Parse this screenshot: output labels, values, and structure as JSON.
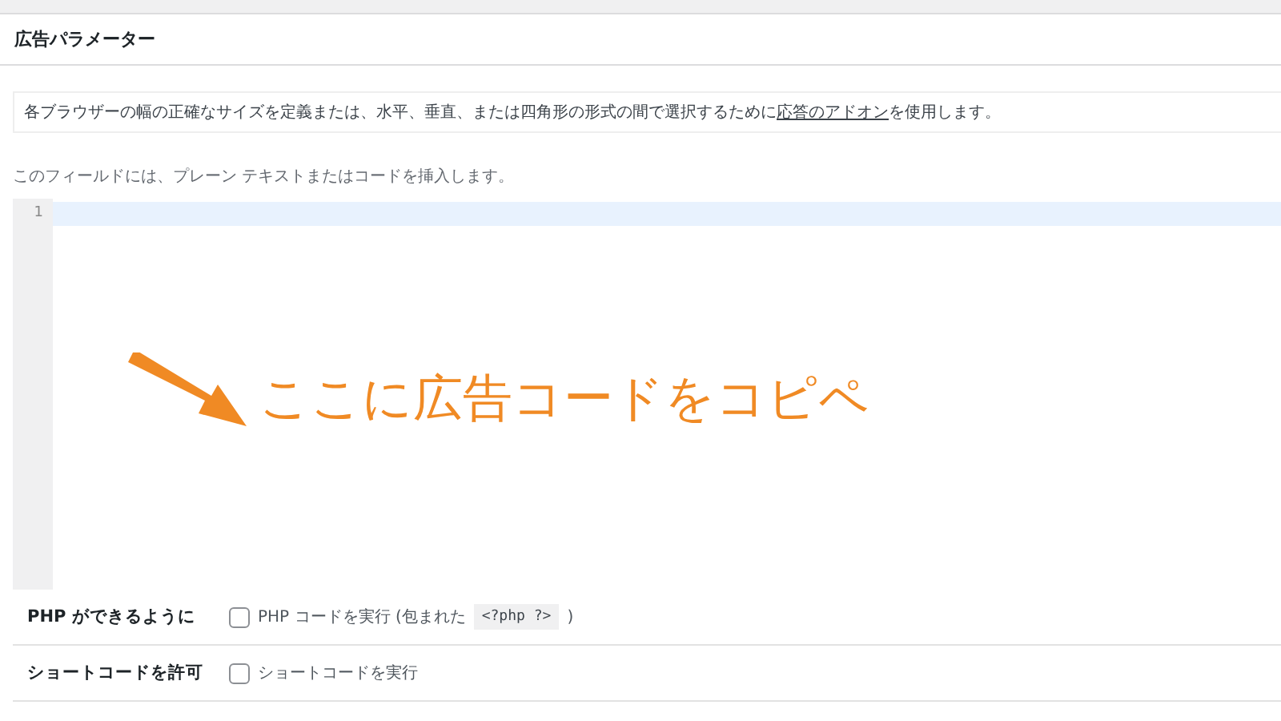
{
  "section_title": "広告パラメーター",
  "notice": {
    "text_before": "各ブラウザーの幅の正確なサイズを定義または、水平、垂直、または四角形の形式の間で選択するために",
    "link": "応答のアドオン",
    "text_after": "を使用します。"
  },
  "field_hint": "このフィールドには、プレーン テキストまたはコードを挿入します。",
  "editor": {
    "line_numbers": [
      "1"
    ]
  },
  "annotation": "ここに広告コードをコピペ",
  "options": [
    {
      "label": "PHP ができるように",
      "checkbox_label": "PHP コードを実行 (包まれた",
      "code": "<?php ?>",
      "suffix": ")",
      "checked": false
    },
    {
      "label": "ショートコードを許可",
      "checkbox_label": "ショートコードを実行",
      "checked": false
    }
  ]
}
